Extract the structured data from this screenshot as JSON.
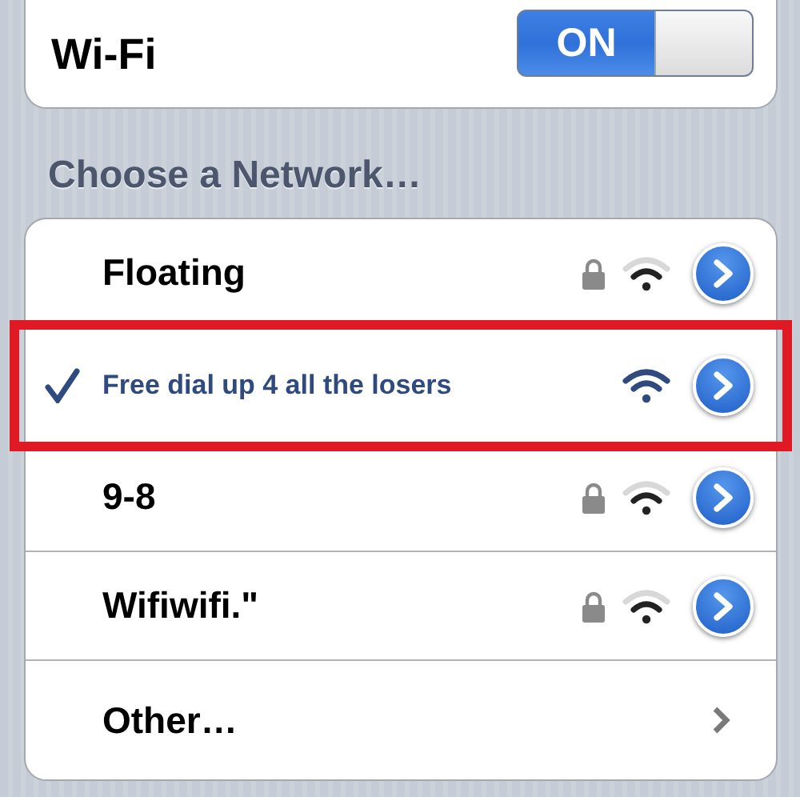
{
  "wifi": {
    "label": "Wi-Fi",
    "on": true,
    "switch_label": "ON"
  },
  "section_header": "Choose a Network…",
  "networks": [
    {
      "kind": "network",
      "name": "Floating",
      "selected": false,
      "secured": true
    },
    {
      "kind": "network",
      "name": "Free dial up 4 all the losers",
      "selected": true,
      "secured": false
    },
    {
      "kind": "network",
      "name": "9-8",
      "selected": false,
      "secured": true
    },
    {
      "kind": "network",
      "name": "Wifiwifi.\"",
      "selected": false,
      "secured": true
    },
    {
      "kind": "other",
      "name": "Other…"
    }
  ]
}
